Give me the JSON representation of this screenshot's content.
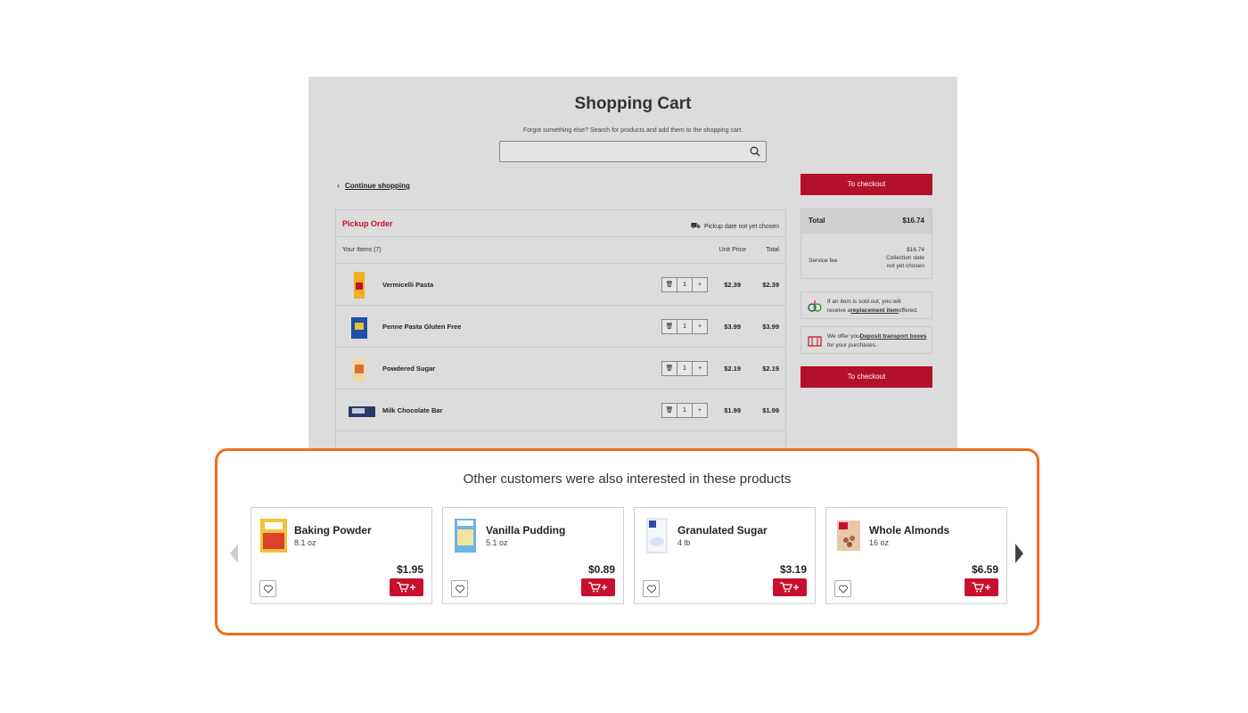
{
  "cart": {
    "title": "Shopping Cart",
    "subtitle": "Forgot something else? Search for products and add them to the shopping cart.",
    "search_placeholder": "",
    "continue_label": "Continue shopping",
    "order_title": "Pickup Order",
    "pickup_status": "Pickup date not yet chosen",
    "items_header": "Your Items (7)",
    "unit_price_header": "Unit Price",
    "total_header": "Total",
    "items": [
      {
        "name": "Vermicelli Pasta",
        "qty": "1",
        "price": "$2.39",
        "total": "$2.39"
      },
      {
        "name": "Penne Pasta Gluten Free",
        "qty": "1",
        "price": "$3.99",
        "total": "$3.99"
      },
      {
        "name": "Powdered Sugar",
        "qty": "1",
        "price": "$2.19",
        "total": "$2.19"
      },
      {
        "name": "Milk Chocolate Bar",
        "qty": "1",
        "price": "$1.99",
        "total": "$1.99"
      }
    ],
    "checkout_label": "To checkout",
    "summary": {
      "total_label": "Total",
      "total_value": "$16.74",
      "fee_label": "Service fee",
      "fee_value": "$16.74",
      "fee_note_1": "Collection date",
      "fee_note_2": "not yet chosen"
    },
    "info_replacement": {
      "pre": "If an item is sold out, you will",
      "line2_pre": "receive a",
      "link": "replacement item",
      "post": "offered."
    },
    "info_boxes": {
      "pre": "We offer you",
      "link": "Deposit transport boxes",
      "line2": "for your purchases."
    }
  },
  "recommendations": {
    "title": "Other customers were also interested in these products",
    "products": [
      {
        "name": "Baking Powder",
        "size": "8.1 oz",
        "price": "$1.95"
      },
      {
        "name": "Vanilla Pudding",
        "size": "5.1 oz",
        "price": "$0.89"
      },
      {
        "name": "Granulated Sugar",
        "size": "4 lb",
        "price": "$3.19"
      },
      {
        "name": "Whole Almonds",
        "size": "16 oz",
        "price": "$6.59"
      }
    ]
  },
  "colors": {
    "brand_red": "#c8102e",
    "highlight_orange": "#f26b1d",
    "cart_grey": "#dcdcdc"
  }
}
